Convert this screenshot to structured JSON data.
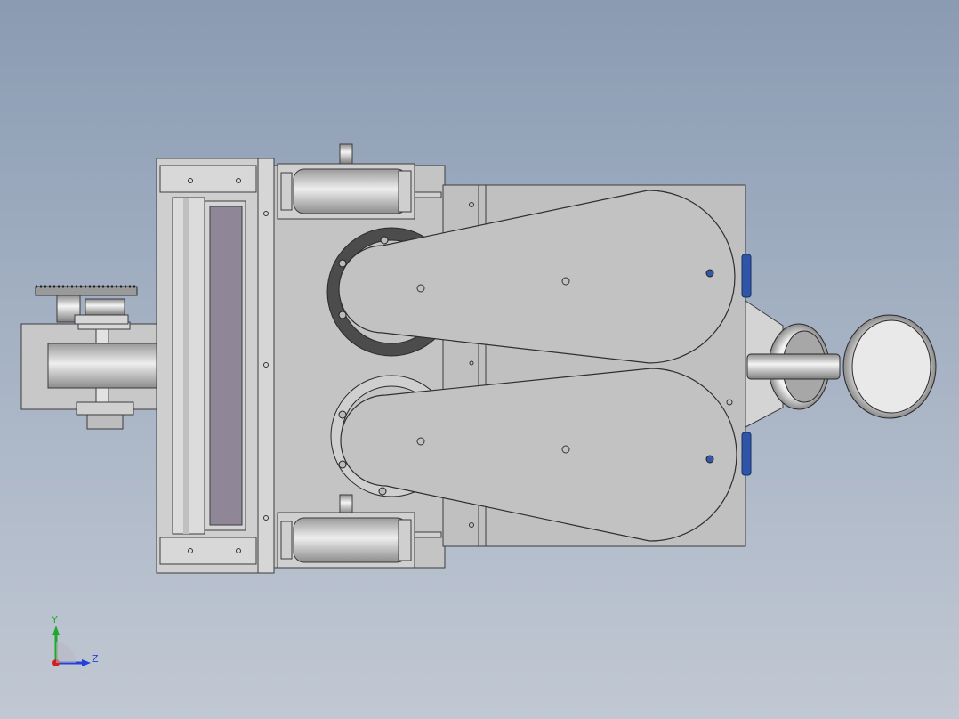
{
  "viewport": {
    "background_top": "#8a9bb2",
    "background_bottom": "#c1c8d3",
    "view": "top"
  },
  "model": {
    "body_color": "#c4c4c4",
    "plate_color": "#b9b9b9",
    "edge_color": "#3c3c3c",
    "accent_blue": "#2f55a8",
    "pad_color": "#8f8798"
  },
  "triad": {
    "y_label": "Y",
    "z_label": "Z",
    "y_color": "#1fa82a",
    "z_color": "#2640d8",
    "x_color": "#d02020"
  }
}
